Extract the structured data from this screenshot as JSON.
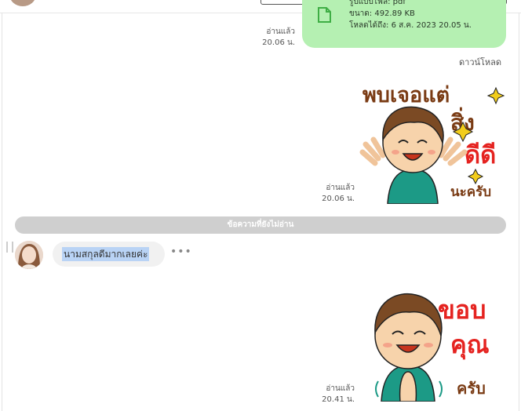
{
  "file_message": {
    "lines": [
      "รูปแบบไฟล์: pdf",
      "ขนาด: 492.89 KB",
      "โหลดได้ถึง: 6 ส.ค. 2023 20.05 น."
    ],
    "read_status": "อ่านแล้ว",
    "time": "20.06 น.",
    "download_label": "ดาวน์โหลด",
    "icon": "file-icon",
    "bubble_color": "#b5f0b2"
  },
  "sticker_message_1": {
    "sticker_text": [
      "พบเจอแต่",
      "สิ่ง",
      "ดีดี",
      "นะครับ"
    ],
    "read_status": "อ่านแล้ว",
    "time": "20.06 น."
  },
  "unread_divider": {
    "label": "ข้อความที่ยังไม่อ่าน"
  },
  "incoming_message": {
    "text": "นามสกุลดีมากเลยค่ะ",
    "more_icon": "more-horizontal-icon"
  },
  "sticker_message_2": {
    "sticker_text": [
      "ขอบ",
      "คุณ",
      "ครับ"
    ],
    "read_status": "อ่านแล้ว",
    "time": "20.41 น."
  }
}
